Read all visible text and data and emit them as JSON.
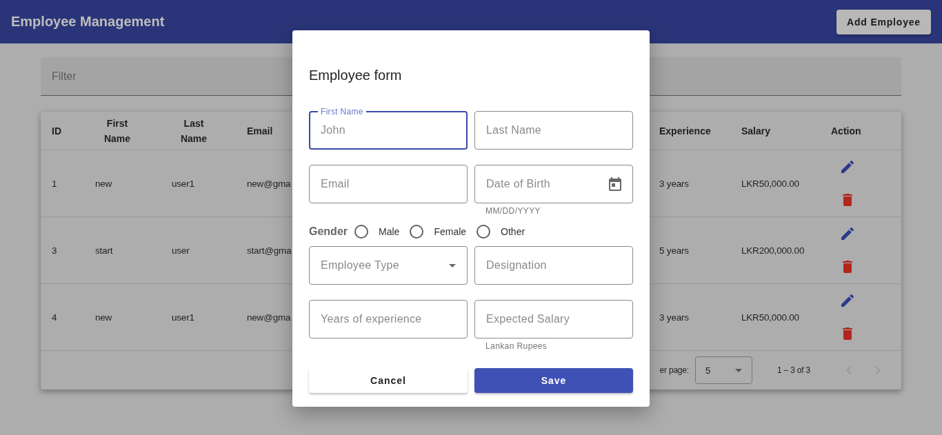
{
  "app_bar": {
    "title": "Employee Management",
    "button": "Add Employee"
  },
  "filter": {
    "placeholder": "Filter"
  },
  "table": {
    "columns": [
      "ID",
      "First Name",
      "Last Name",
      "Email",
      "Experience",
      "Salary",
      "Action"
    ],
    "rows": [
      {
        "id": "1",
        "first_name": "new",
        "last_name": "user1",
        "email": "new@gma",
        "experience": "3 years",
        "salary": "LKR50,000.00"
      },
      {
        "id": "3",
        "first_name": "start",
        "last_name": "user",
        "email": "start@gma",
        "experience": "5 years",
        "salary": "LKR200,000.00"
      },
      {
        "id": "4",
        "first_name": "new",
        "last_name": "user1",
        "email": "new@gma",
        "experience": "3 years",
        "salary": "LKR50,000.00"
      }
    ]
  },
  "paginator": {
    "items_per_page_label": "er page:",
    "page_size": "5",
    "range": "1 – 3 of 3"
  },
  "dialog": {
    "title": "Employee form",
    "rows": [
      {
        "kind": "fields",
        "fields": [
          {
            "kind": "text",
            "label": "First Name",
            "placeholder": "John",
            "focused": true
          },
          {
            "kind": "text",
            "label": "Last Name",
            "focused": false
          }
        ]
      },
      {
        "kind": "fields",
        "fields": [
          {
            "kind": "text",
            "label": "Email",
            "focused": false
          },
          {
            "kind": "date",
            "label": "Date of Birth",
            "hint": "MM/DD/YYYY",
            "focused": false
          }
        ]
      },
      {
        "kind": "radio",
        "label": "Gender",
        "options": [
          {
            "label": "Male",
            "selected": false
          },
          {
            "label": "Female",
            "selected": false
          },
          {
            "label": "Other",
            "selected": false
          }
        ]
      },
      {
        "kind": "fields",
        "fields": [
          {
            "kind": "select",
            "label": "Employee Type",
            "focused": false
          },
          {
            "kind": "text",
            "label": "Designation",
            "focused": false
          }
        ]
      },
      {
        "kind": "fields",
        "fields": [
          {
            "kind": "text",
            "label": "Years of experience",
            "focused": false
          },
          {
            "kind": "text",
            "label": "Expected Salary",
            "hint": "Lankan Rupees",
            "focused": false
          }
        ]
      }
    ],
    "buttons": [
      {
        "label": "Cancel",
        "kind": "secondary"
      },
      {
        "label": "Save",
        "kind": "primary"
      }
    ]
  }
}
